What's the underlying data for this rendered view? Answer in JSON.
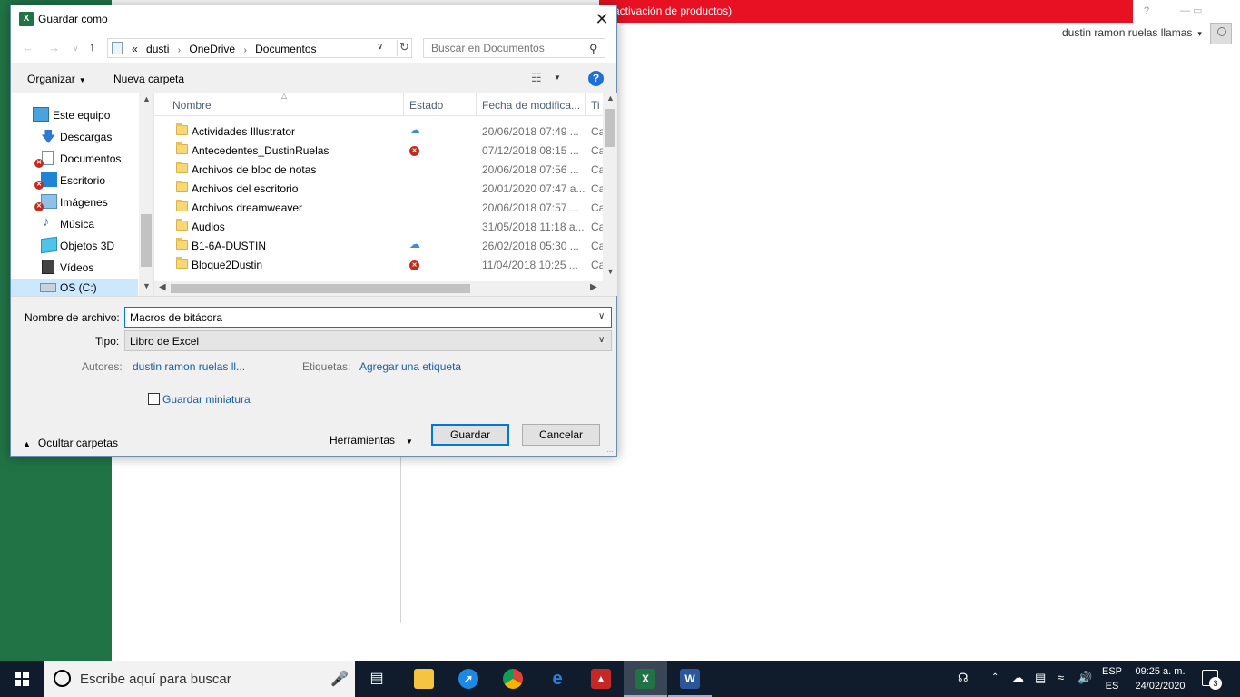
{
  "background": {
    "banner_text": "activación de productos)",
    "user_name": "dustin ramon ruelas llamas",
    "help": "?",
    "minmax": "— ▭"
  },
  "dialog": {
    "title": "Guardar como",
    "title_icon": "X",
    "close": "✕",
    "address": {
      "prefix": "«",
      "crumbs": [
        "dusti",
        "OneDrive",
        "Documentos"
      ],
      "separator": "›"
    },
    "search_placeholder": "Buscar en Documentos",
    "toolbar": {
      "organize": "Organizar",
      "new_folder": "Nueva carpeta",
      "help": "?"
    },
    "nav_items": [
      {
        "label": "Este equipo",
        "icon": "computer-icon",
        "error": false
      },
      {
        "label": "Descargas",
        "icon": "download-arrow-icon",
        "error": false
      },
      {
        "label": "Documentos",
        "icon": "document-icon",
        "error": true
      },
      {
        "label": "Escritorio",
        "icon": "desktop-icon",
        "error": true
      },
      {
        "label": "Imágenes",
        "icon": "pictures-icon",
        "error": true
      },
      {
        "label": "Música",
        "icon": "music-icon",
        "error": false
      },
      {
        "label": "Objetos 3D",
        "icon": "cube-3d-icon",
        "error": false
      },
      {
        "label": "Vídeos",
        "icon": "video-icon",
        "error": false
      },
      {
        "label": "OS (C:)",
        "icon": "drive-icon",
        "error": false
      }
    ],
    "columns": {
      "name": "Nombre",
      "status": "Estado",
      "date": "Fecha de modifica...",
      "type": "Ti"
    },
    "files": [
      {
        "name": "Actividades Illustrator",
        "status": "cloud",
        "date": "20/06/2018 07:49 ...",
        "type": "Ca"
      },
      {
        "name": "Antecedentes_DustinRuelas",
        "status": "error",
        "date": "07/12/2018 08:15 ...",
        "type": "Ca"
      },
      {
        "name": "Archivos de bloc de notas",
        "status": "",
        "date": "20/06/2018 07:56 ...",
        "type": "Ca"
      },
      {
        "name": "Archivos del escritorio",
        "status": "",
        "date": "20/01/2020 07:47 a...",
        "type": "Ca"
      },
      {
        "name": "Archivos dreamweaver",
        "status": "",
        "date": "20/06/2018 07:57 ...",
        "type": "Ca"
      },
      {
        "name": "Audios",
        "status": "",
        "date": "31/05/2018 11:18 a...",
        "type": "Ca"
      },
      {
        "name": "B1-6A-DUSTIN",
        "status": "cloud",
        "date": "26/02/2018 05:30 ...",
        "type": "Ca"
      },
      {
        "name": "Bloque2Dustin",
        "status": "error",
        "date": "11/04/2018 10:25 ...",
        "type": "Ca"
      }
    ],
    "form": {
      "filename_label": "Nombre de archivo:",
      "filename_value": "Macros de bitácora",
      "type_label": "Tipo:",
      "type_value": "Libro de Excel",
      "authors_label": "Autores:",
      "authors_value": "dustin ramon ruelas ll...",
      "tags_label": "Etiquetas:",
      "tags_value": "Agregar una etiqueta",
      "thumbnail_label": "Guardar miniatura",
      "hide_folders": "Ocultar carpetas",
      "tools": "Herramientas",
      "save": "Guardar",
      "cancel": "Cancelar"
    }
  },
  "taskbar": {
    "search_text": "Escribe aquí para buscar",
    "lang_top": "ESP",
    "lang_bottom": "ES",
    "time": "09:25 a. m.",
    "date": "24/02/2020",
    "notifications": "3",
    "apps": [
      "task-view-icon",
      "file-explorer-icon",
      "safari-icon",
      "chrome-icon",
      "edge-icon",
      "app-red-icon",
      "excel-icon",
      "word-icon"
    ]
  },
  "colors": {
    "excel_green": "#217346",
    "banner_red": "#e81123",
    "accent_blue": "#0078d7",
    "taskbar": "#101c2c"
  }
}
